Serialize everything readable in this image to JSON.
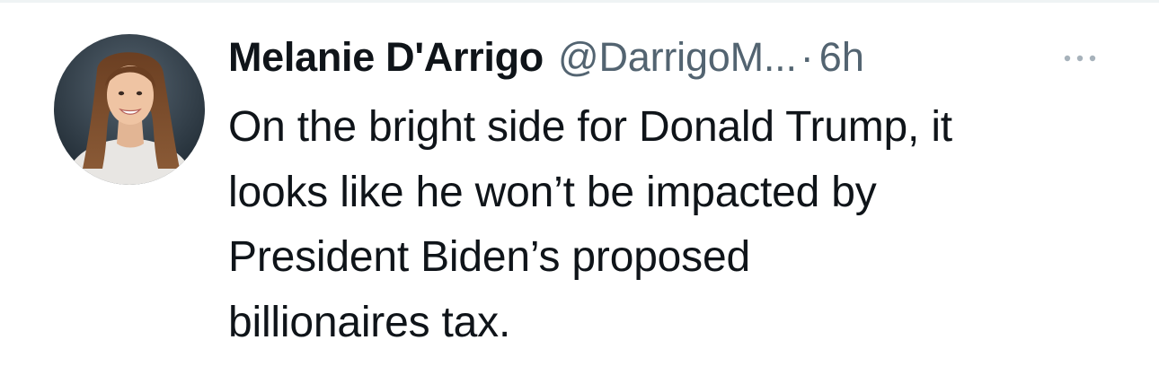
{
  "tweet": {
    "display_name": "Melanie D'Arrigo",
    "handle": "@DarrigoM...",
    "separator": "·",
    "time": "6h",
    "text": "On the bright side for Donald Trump, it\nlooks like he won’t be impacted by\nPresident Biden’s proposed\nbillionaires tax.",
    "avatar_icon": "profile-photo",
    "more_icon": "more-horizontal-icon"
  },
  "colors": {
    "primary_text": "#0f1419",
    "secondary_text": "#536471",
    "divider": "#eff3f4",
    "background": "#ffffff"
  }
}
